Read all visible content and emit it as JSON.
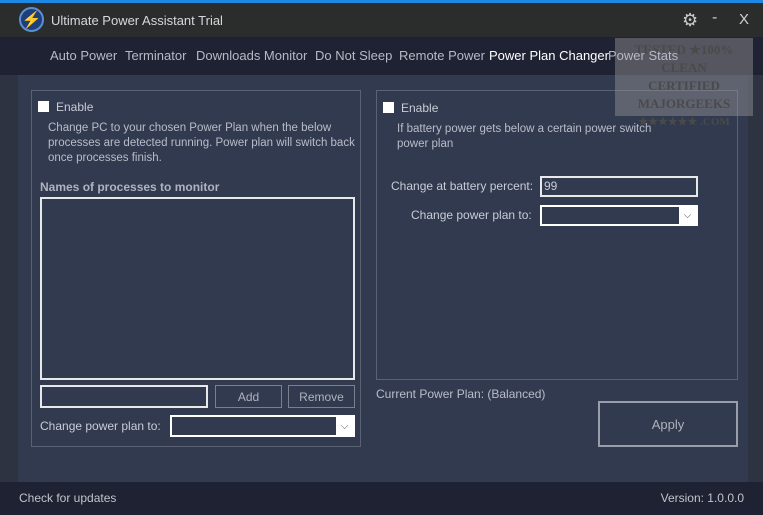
{
  "window": {
    "title": "Ultimate Power Assistant Trial",
    "minimize": "-",
    "close": "X"
  },
  "tabs": [
    "Auto Power",
    "Terminator",
    "Downloads Monitor",
    "Do Not Sleep",
    "Remote Power",
    "Power Plan Changer",
    "Power Stats"
  ],
  "active_tab": "Power Plan Changer",
  "left": {
    "enable": "Enable",
    "description": "Change PC to your chosen Power Plan when the below processes are detected running. Power plan will switch back once processes finish.",
    "list_title": "Names of processes to monitor",
    "process_input": "",
    "add": "Add",
    "remove": "Remove",
    "plan_label": "Change power plan to:",
    "plan_value": ""
  },
  "right": {
    "enable": "Enable",
    "description": "If battery power gets below a certain power switch power plan",
    "battery_label": "Change at battery percent:",
    "battery_value": "99",
    "plan_label": "Change power plan to:",
    "plan_value": ""
  },
  "current_plan": "Current Power Plan: (Balanced)",
  "apply": "Apply",
  "footer": {
    "updates": "Check for updates",
    "version": "Version: 1.0.0.0"
  },
  "watermark": {
    "line1": "TESTED ★100% CLEAN",
    "line2": "CERTIFIED",
    "line3": "MAJORGEEKS",
    "line4": "★★★★★★ .COM"
  }
}
